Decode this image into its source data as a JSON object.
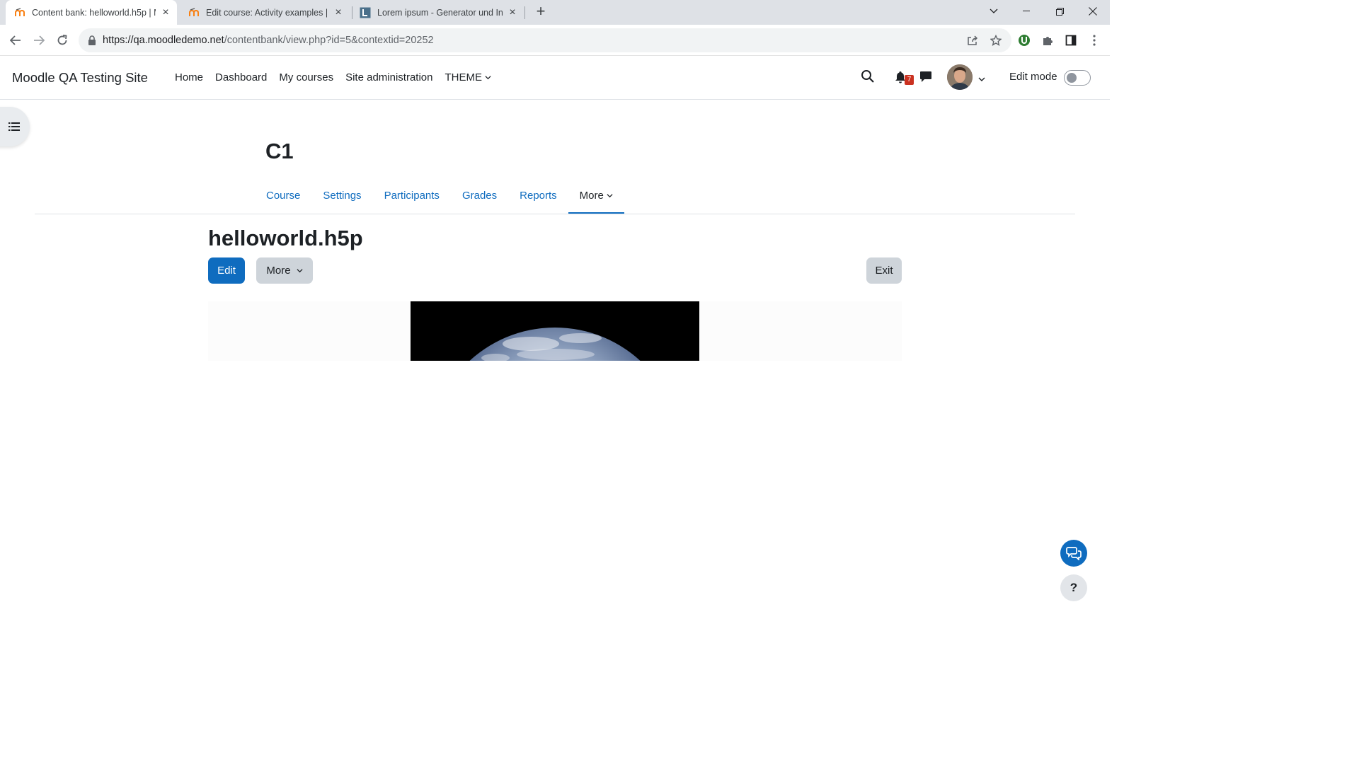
{
  "browser": {
    "tabs": [
      {
        "title": "Content bank: helloworld.h5p | M",
        "active": true
      },
      {
        "title": "Edit course: Activity examples | M",
        "active": false
      },
      {
        "title": "Lorem ipsum - Generator und Inf",
        "active": false
      }
    ],
    "url_host": "https://qa.moodledemo.net",
    "url_path": "/contentbank/view.php?id=5&contextid=20252"
  },
  "navbar": {
    "brand": "Moodle QA Testing Site",
    "items": [
      "Home",
      "Dashboard",
      "My courses",
      "Site administration",
      "THEME"
    ],
    "notification_count": "7",
    "edit_mode_label": "Edit mode",
    "edit_mode_on": false
  },
  "course": {
    "title": "C1",
    "secondary_nav": [
      "Course",
      "Settings",
      "Participants",
      "Grades",
      "Reports",
      "More"
    ],
    "active_tab": "More"
  },
  "content": {
    "title": "helloworld.h5p",
    "edit_label": "Edit",
    "more_label": "More",
    "exit_label": "Exit"
  },
  "fab": {
    "help_label": "?"
  },
  "colors": {
    "primary": "#0f6cbf",
    "badge": "#ca3120"
  }
}
